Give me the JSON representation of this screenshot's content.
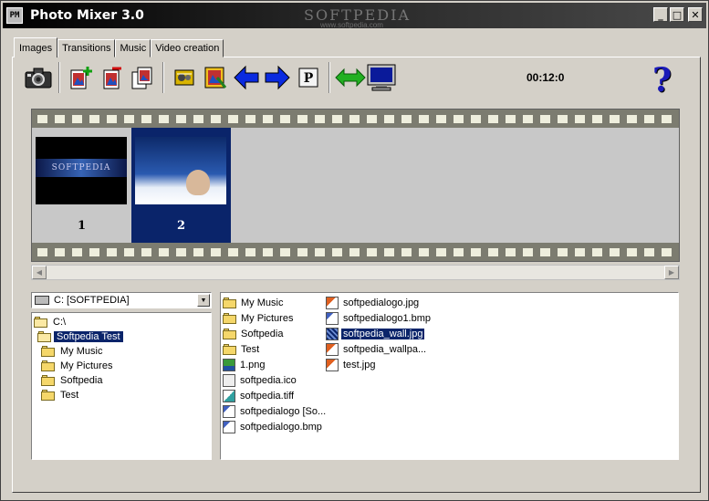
{
  "window": {
    "title": "Photo Mixer 3.0",
    "watermark": "SOFTPEDIA",
    "watermark_url": "www.softpedia.com",
    "controls": {
      "minimize": "_",
      "maximize": "□",
      "close": "✕"
    }
  },
  "tabs": [
    {
      "label": "Images",
      "active": true
    },
    {
      "label": "Transitions",
      "active": false
    },
    {
      "label": "Music",
      "active": false
    },
    {
      "label": "Video creation",
      "active": false
    }
  ],
  "toolbar": {
    "buttons": [
      "camera-icon",
      "add-image-icon",
      "remove-image-icon",
      "copy-image-icon",
      "settings-icon",
      "image-effects-icon",
      "arrow-left-icon",
      "arrow-right-icon",
      "p-icon",
      "swap-arrows-icon",
      "monitor-icon"
    ],
    "time": "00:12:0",
    "help_glyph": "?"
  },
  "filmstrip": {
    "frames": [
      {
        "number": "1",
        "selected": false,
        "thumb_text": "SOFTPEDIA"
      },
      {
        "number": "2",
        "selected": true,
        "thumb_text": ""
      }
    ]
  },
  "drive": {
    "label": "C: [SOFTPEDIA]"
  },
  "tree": {
    "items": [
      {
        "label": "C:\\",
        "level": 0,
        "open": true,
        "selected": false
      },
      {
        "label": "Softpedia Test",
        "level": 1,
        "open": true,
        "selected": true
      },
      {
        "label": "My Music",
        "level": 2,
        "open": false,
        "selected": false
      },
      {
        "label": "My Pictures",
        "level": 2,
        "open": false,
        "selected": false
      },
      {
        "label": "Softpedia",
        "level": 2,
        "open": false,
        "selected": false
      },
      {
        "label": "Test",
        "level": 2,
        "open": false,
        "selected": false
      }
    ]
  },
  "files": {
    "col1": [
      {
        "label": "My Music",
        "type": "folder"
      },
      {
        "label": "My Pictures",
        "type": "folder"
      },
      {
        "label": "Softpedia",
        "type": "folder"
      },
      {
        "label": "Test",
        "type": "folder"
      },
      {
        "label": "1.png",
        "type": "png"
      },
      {
        "label": "softpedia.ico",
        "type": "ico"
      },
      {
        "label": "softpedia.tiff",
        "type": "tiff"
      },
      {
        "label": "softpedialogo [So...",
        "type": "bmp"
      },
      {
        "label": "softpedialogo.bmp",
        "type": "bmp"
      }
    ],
    "col2": [
      {
        "label": "softpedialogo.jpg",
        "type": "jpg",
        "selected": false
      },
      {
        "label": "softpedialogo1.bmp",
        "type": "bmp",
        "selected": false
      },
      {
        "label": "softpedia_wall.jpg",
        "type": "jpg",
        "selected": true
      },
      {
        "label": "softpedia_wallpa...",
        "type": "jpg",
        "selected": false
      },
      {
        "label": "test.jpg",
        "type": "jpg",
        "selected": false
      }
    ]
  },
  "colors": {
    "selection": "#0a246a",
    "face": "#d4d0c8",
    "arrow_blue": "#0a2ae0",
    "arrow_green": "#22b022"
  }
}
